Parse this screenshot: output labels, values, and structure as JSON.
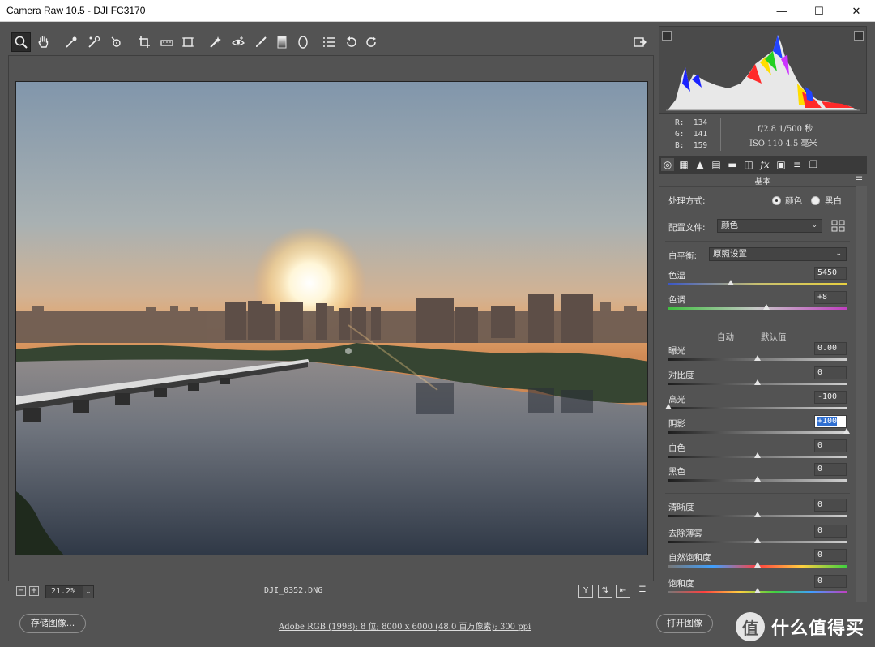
{
  "window": {
    "title": "Camera Raw 10.5 -  DJI FC3170",
    "minimize": "—",
    "maximize": "☐",
    "close": "✕"
  },
  "toolbar": {
    "tools": [
      "zoom-tool",
      "hand-tool",
      "white-balance-tool",
      "color-sampler-tool",
      "targeted-adjustment-tool",
      "crop-tool",
      "straighten-tool",
      "transform-tool",
      "spot-removal-tool",
      "red-eye-tool",
      "adjustment-brush-tool",
      "graduated-filter-tool",
      "radial-filter-tool",
      "preferences",
      "rotate-ccw",
      "rotate-cw"
    ]
  },
  "image_footer": {
    "zoom_minus": "−",
    "zoom_plus": "+",
    "zoom_level": "21.2%",
    "filename": "DJI_0352.DNG",
    "btn_y": "Y"
  },
  "histogram": {
    "r": "134",
    "g": "141",
    "b": "159",
    "r_label": "R:",
    "g_label": "G:",
    "b_label": "B:",
    "aperture_shutter": "f/2.8  1/500 秒",
    "iso_focal": "ISO 110  4.5 毫米"
  },
  "panel": {
    "section_title": "基本",
    "treatment_label": "处理方式:",
    "treatment_color": "颜色",
    "treatment_bw": "黑白",
    "profile_label": "配置文件:",
    "profile_value": "颜色",
    "wb_label": "白平衡:",
    "wb_value": "原照设置",
    "auto_link": "自动",
    "default_link": "默认值",
    "sliders": [
      {
        "label": "色温",
        "value": "5450",
        "position": 0.35
      },
      {
        "label": "色调",
        "value": "+8",
        "position": 0.55
      },
      {
        "label": "曝光",
        "value": "0.00",
        "position": 0.5
      },
      {
        "label": "对比度",
        "value": "0",
        "position": 0.5
      },
      {
        "label": "高光",
        "value": "-100",
        "position": 0.0
      },
      {
        "label": "阴影",
        "value": "+100",
        "position": 1.0
      },
      {
        "label": "白色",
        "value": "0",
        "position": 0.5
      },
      {
        "label": "黑色",
        "value": "0",
        "position": 0.5
      },
      {
        "label": "清晰度",
        "value": "0",
        "position": 0.5
      },
      {
        "label": "去除薄雾",
        "value": "0",
        "position": 0.5
      },
      {
        "label": "自然饱和度",
        "value": "0",
        "position": 0.5
      },
      {
        "label": "饱和度",
        "value": "0",
        "position": 0.5
      }
    ]
  },
  "footer": {
    "save_label": "存储图像...",
    "workflow_info": "Adobe RGB (1998); 8 位; 8000 x 6000 (48.0 百万像素); 300 ppi",
    "open_label": "打开图像",
    "brand_text": "什么值得买",
    "brand_logo": "值"
  },
  "colors": {
    "accent_selection": "#2f6fd1",
    "panel_bg": "#535353",
    "tab_bar": "#3a3a3a"
  }
}
